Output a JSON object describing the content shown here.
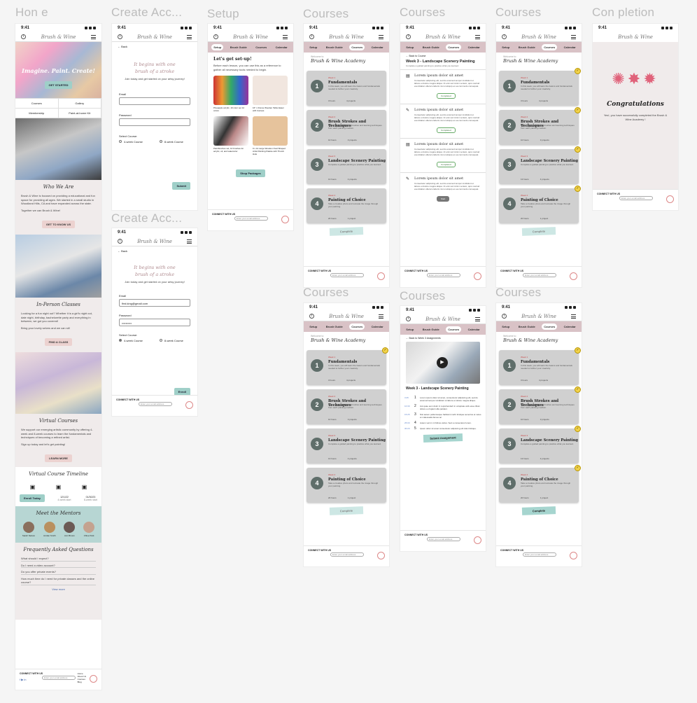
{
  "labels": {
    "home": "Hon e",
    "create1": "Create Acc...",
    "create2": "Create Acc...",
    "setup": "Setup",
    "courses1": "Courses",
    "courses2": "Courses",
    "courses3": "Courses",
    "courses4": "Courses",
    "courses5": "Courses",
    "courses6": "Courses",
    "completion": "Con pletion"
  },
  "common": {
    "time": "9:41",
    "logo": "Brush & Wine",
    "footer_connect": "CONNECT WITH US",
    "footer_input": "Enter your email address",
    "footer_links": [
      "Home",
      "About Us",
      "Courses",
      "Blog",
      "FAQ"
    ],
    "footer_social": "f ▶ in"
  },
  "tabs": [
    "Setup",
    "Brush Guide",
    "Courses",
    "Calendar"
  ],
  "home": {
    "hero_title": "Imagine. Paint. Create!",
    "get_started": "GET STARTED",
    "grid": [
      "Courses",
      "Gallery",
      "Membership",
      "Paint-at-home Kit"
    ],
    "who_title": "Who We Are",
    "who_text": "Brush & Wine is focused on providing a educational and fun space for providing all ages. We started in a small studio in Woodland Hills, CA and have expanded across the state.",
    "together": "Together we can Brush & Wine!",
    "get_to_know": "GET TO KNOW US",
    "inperson_title": "In-Person Classes",
    "inperson_text": "Looking for a fun night out? Whether it is a girl's night out, date night, birthday, bachelorette party and everything in between, we got you covered!",
    "bring": "Bring your lovely selves and we can sit!",
    "find_class": "FIND A CLASS",
    "virtual_title": "Virtual Courses",
    "virtual_text": "We support our emerging artistic community by offering 4-week and 8-week courses to learn the fundamentals and techniques of becoming a refined artist.",
    "signup": "Sign up today and let's get painting!",
    "learn_more": "LEARN MORE",
    "timeline_title": "Virtual Course Timeline",
    "enroll": "Enroll Today",
    "dates": [
      "12/1/22",
      "01/30/23"
    ],
    "date_subs": [
      "4-week start",
      "8-week start"
    ],
    "mentors_title": "Meet the Mentors",
    "mentors": [
      "Sarah Nelson",
      "Jordan Smith",
      "Ann Brown",
      "Chloe Park"
    ],
    "faq_title": "Frequently Asked Questions",
    "faqs": [
      "What should I expect?",
      "Do I need a video account?",
      "Do you offer private events?",
      "How much time do I need for private classes and the online course?"
    ],
    "view_more": "View more"
  },
  "create": {
    "back": "← Back",
    "title1": "It begins with one",
    "title2": "brush of a stroke",
    "subtitle": "Join today and get started on your artsy journey!",
    "email_label": "Email",
    "password_label": "Password",
    "select_label": "Select Course:",
    "opt1": "4-week Course",
    "opt2": "8-week Course",
    "submit": "Submit",
    "email_value": "first.king@gmail.com",
    "password_value": "••••••••••",
    "enroll": "Enroll"
  },
  "setup": {
    "title": "Let's get set-up!",
    "intro": "Before each lesson, you can use this as a reference to gather all necessary tools needed to begin.",
    "items": [
      "Pineapple acrylic, 10 color set 12 colors",
      "16\" x Frame Wooden Table Easel with Canvas",
      "Paintbrushes set, 10 brushes for acrylic, oil, and watercolor",
      "9 x 12 Large Wooden Oval Shaped Artist Painting Palette with Thumb Hole"
    ],
    "shop": "Shop Packages"
  },
  "courses": {
    "welcome": "Welcome to",
    "academy": "Brush & Wine Academy",
    "cards": [
      {
        "n": "1",
        "week": "Week 1",
        "title": "Fundamentals",
        "desc": "In this week, you will learn the basics and fundamentals needed to further your creativity.",
        "m1": "3 hours",
        "m2": "4 projects"
      },
      {
        "n": "2",
        "week": "Week 2",
        "title": "Brush Strokes and Techniques",
        "desc": "Begin practicing with the brushes and learning techniques from each painting medium.",
        "m1": "10 hours",
        "m2": "3 projects"
      },
      {
        "n": "3",
        "week": "Week 3",
        "title": "Landscape Scenery Painting",
        "desc": "Complete a guided painting to practice what you learned.",
        "m1": "13 hours",
        "m2": "4 projects"
      },
      {
        "n": "4",
        "week": "Week 4",
        "title": "Painting of Choice",
        "desc": "Take a creative photo and recreate the image through your painting.",
        "m1": "20 hours",
        "m2": "1 project"
      }
    ],
    "complete": "Complete",
    "back_courses": "← Back to Course",
    "week3": "Week 3 - Landscape Scenery Painting",
    "week3_sub": "Complete a guided painting to practice what you learned.",
    "lorem_title": "Lorem ipsum dolor sit amet",
    "lorem_text": "Consectetur adipiscing elit, sed do eiusmod tempor incididunt ut labore et dolore magna aliqua. Ut enim ad minim veniam, quis nostrud exercitation ullamco laboris nisi ut aliquip ex ea commodo consequat.",
    "completed": "Completed",
    "start": "Start",
    "back_assign": "← Back to Week 3 Assignments",
    "video_title": "Week 3 - Landscape Scenery Painting",
    "times": [
      "3:25",
      "10:30",
      "15:25",
      "25:00",
      "30:20"
    ],
    "steps": [
      "Lorem ipsum dolor sit amet, consectetur adipiscing elit, sed do eiusmod tempor incididunt ut labore et dolore magna aliqua.",
      "Aut quae eum dolor in reprehenderit in voluptate velit esse cillum dolore eu fugiat nulla pariatur.",
      "Nisi autem pellentesque habitant morbi tristique senectus et netus et malesuada fames ac.",
      "Autem veit in in finibus varius. Sed a consectetur lorem.",
      "Ipsum dolor sit amet consectetur adipiscing elit duis tristique."
    ],
    "submit_assign": "Submit Assignment"
  },
  "completion": {
    "title": "Congratulations",
    "text": "Yes!, you have successfully completed the Brush & Wine Academy !"
  }
}
